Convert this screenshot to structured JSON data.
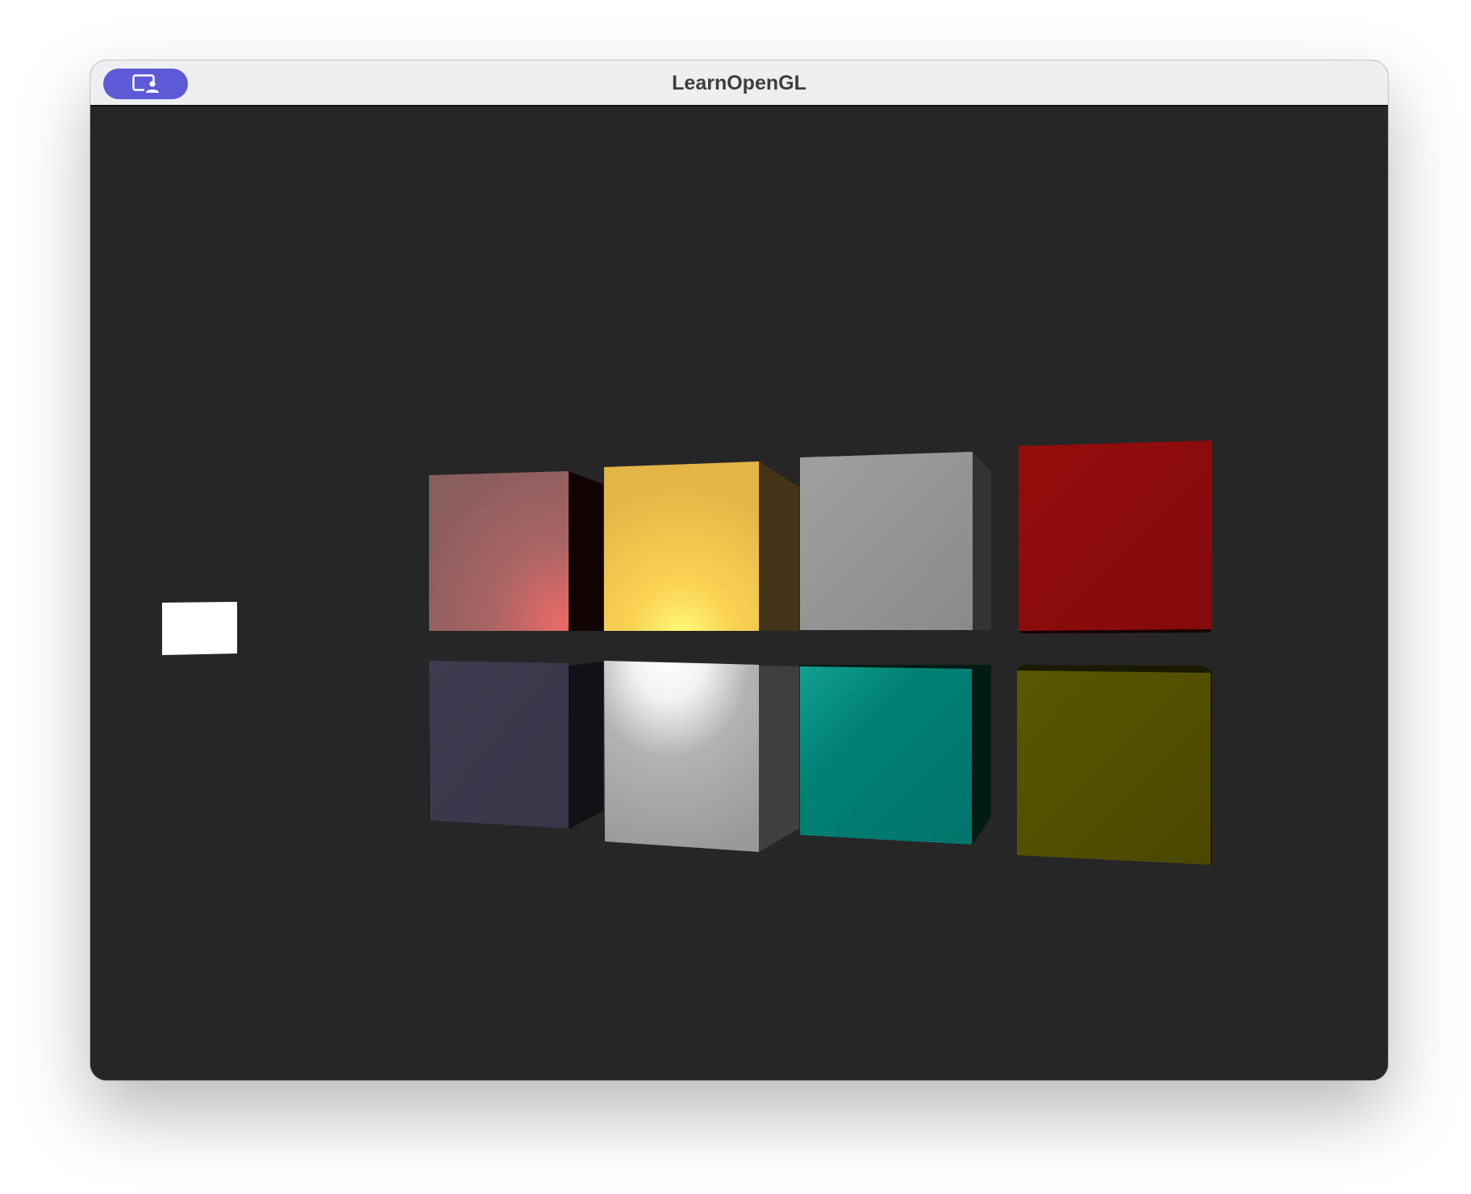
{
  "window": {
    "title": "LearnOpenGL"
  },
  "titlebar": {
    "share_button_icon": "screen-share-person-icon",
    "share_button_color": "#5d5ad8"
  },
  "scene": {
    "background_color": "#262626",
    "light_source_color": "#ffffff",
    "cubes": [
      {
        "row": 1,
        "col": 1,
        "name": "cube-rose",
        "front_color": "#a0625f",
        "side_color": "#120303"
      },
      {
        "row": 1,
        "col": 2,
        "name": "cube-gold",
        "front_color": "#e5b446",
        "side_color": "#433418"
      },
      {
        "row": 1,
        "col": 3,
        "name": "cube-silver",
        "front_color": "#8f8f8f",
        "side_color": "#333333"
      },
      {
        "row": 1,
        "col": 4,
        "name": "cube-red",
        "front_color": "#8c0b0b",
        "side_color": "#2a0000"
      },
      {
        "row": 2,
        "col": 1,
        "name": "cube-indigo",
        "front_color": "#3c384b",
        "side_color": "#111116"
      },
      {
        "row": 2,
        "col": 2,
        "name": "cube-white",
        "front_color": "#a6a6a6",
        "side_color": "#3f3f3f"
      },
      {
        "row": 2,
        "col": 3,
        "name": "cube-teal",
        "front_color": "#00786d",
        "side_color": "#001c14"
      },
      {
        "row": 2,
        "col": 4,
        "name": "cube-olive",
        "front_color": "#525000",
        "side_color": "#1a1a00"
      }
    ]
  }
}
